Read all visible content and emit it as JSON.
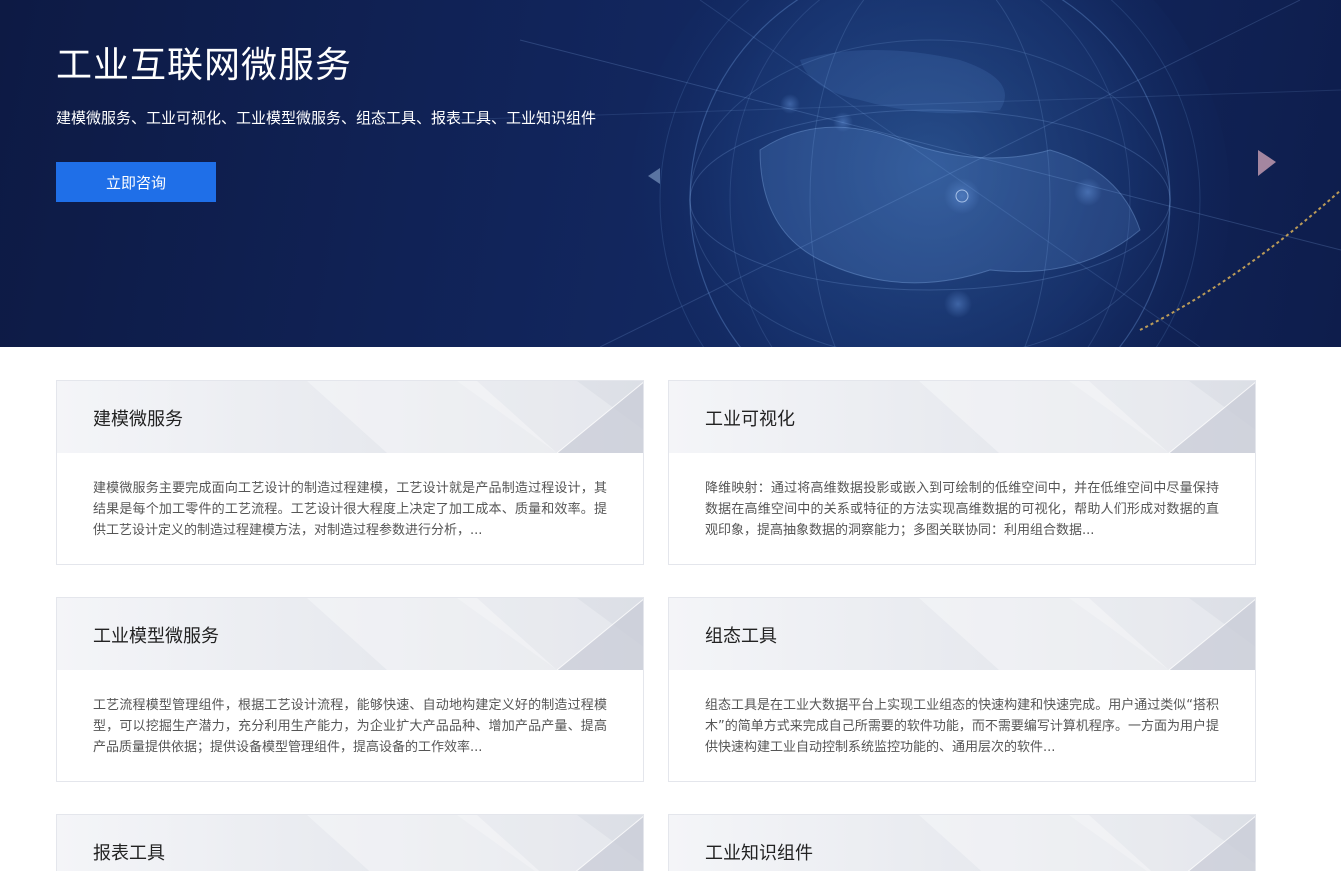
{
  "hero": {
    "title": "工业互联网微服务",
    "subtitle": "建模微服务、工业可视化、工业模型微服务、组态工具、报表工具、工业知识组件",
    "button_label": "立即咨询",
    "accent_color": "#1f6fe8",
    "background_color": "#0d1a44"
  },
  "cards": [
    {
      "title": "建模微服务",
      "description": "建模微服务主要完成面向工艺设计的制造过程建模，工艺设计就是产品制造过程设计，其结果是每个加工零件的工艺流程。工艺设计很大程度上决定了加工成本、质量和效率。提供工艺设计定义的制造过程建模方法，对制造过程参数进行分析，..."
    },
    {
      "title": "工业可视化",
      "description": "降维映射：通过将高维数据投影或嵌入到可绘制的低维空间中，并在低维空间中尽量保持数据在高维空间中的关系或特征的方法实现高维数据的可视化，帮助人们形成对数据的直观印象，提高抽象数据的洞察能力；多图关联协同：利用组合数据..."
    },
    {
      "title": "工业模型微服务",
      "description": "工艺流程模型管理组件，根据工艺设计流程，能够快速、自动地构建定义好的制造过程模型，可以挖掘生产潜力，充分利用生产能力，为企业扩大产品品种、增加产品产量、提高产品质量提供依据；提供设备模型管理组件，提高设备的工作效率..."
    },
    {
      "title": "组态工具",
      "description": "组态工具是在工业大数据平台上实现工业组态的快速构建和快速完成。用户通过类似“搭积木”的简单方式来完成自己所需要的软件功能，而不需要编写计算机程序。一方面为用户提供快速构建工业自动控制系统监控功能的、通用层次的软件..."
    },
    {
      "title": "报表工具",
      "description": ""
    },
    {
      "title": "工业知识组件",
      "description": ""
    }
  ]
}
